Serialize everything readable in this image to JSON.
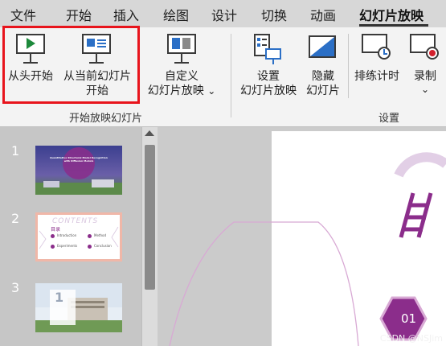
{
  "tabs": [
    "文件",
    "开始",
    "插入",
    "绘图",
    "设计",
    "切换",
    "动画",
    "幻灯片放映"
  ],
  "active_tab_index": 7,
  "ribbon": {
    "from_beginning": "从头开始",
    "from_current_line1": "从当前幻灯片",
    "from_current_line2": "开始",
    "custom_line1": "自定义",
    "custom_line2": "幻灯片放映",
    "custom_chevron": "⌄",
    "setup_line1": "设置",
    "setup_line2": "幻灯片放映",
    "hide_line1": "隐藏",
    "hide_line2": "幻灯片",
    "rehearse": "排练计时",
    "record": "录制",
    "record_chevron": "⌄",
    "group_start": "开始放映幻灯片",
    "group_setup": "设置"
  },
  "slides": [
    {
      "number": "1",
      "title_line1": "Quantitative Structural Model Recognition",
      "title_line2": "with Diffusion Models"
    },
    {
      "number": "2",
      "heading": "CONTENTS",
      "subheading": "目录",
      "items": [
        "Introduction",
        "Method",
        "Experiments",
        "Conclusion"
      ]
    },
    {
      "number": "3",
      "big_digit": "1"
    }
  ],
  "canvas": {
    "section_number": "01"
  },
  "watermark": "CSDN @NSJim",
  "colors": {
    "accent_purple": "#8b2d8b",
    "highlight_red": "#e8141c"
  }
}
